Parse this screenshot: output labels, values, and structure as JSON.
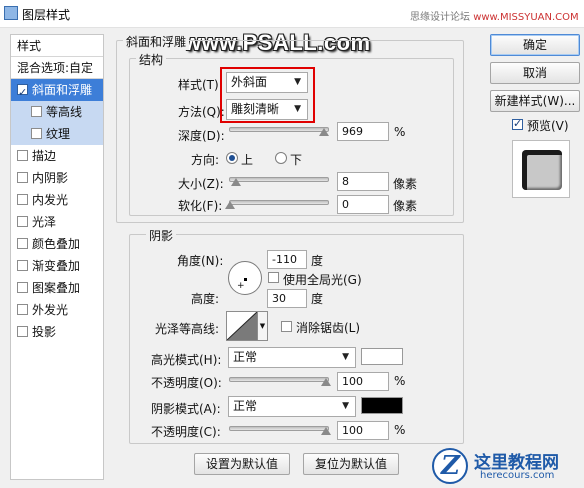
{
  "window": {
    "title": "图层样式"
  },
  "watermarks": {
    "top_text": "思缘设计论坛",
    "top_url": "www.MISSYUAN.COM",
    "overlay": "www.PSALL.com",
    "bottom_name": "这里教程网",
    "bottom_url": "herecours.com",
    "bottom_badge_letter": "Z"
  },
  "sidebar": {
    "header": "样式",
    "blend_options": "混合选项:自定",
    "items": [
      {
        "label": "斜面和浮雕",
        "checked": true,
        "selected": true
      },
      {
        "label": "等高线",
        "checked": false,
        "sub": true
      },
      {
        "label": "纹理",
        "checked": false,
        "sub": true
      },
      {
        "label": "描边",
        "checked": false
      },
      {
        "label": "内阴影",
        "checked": false
      },
      {
        "label": "内发光",
        "checked": false
      },
      {
        "label": "光泽",
        "checked": false
      },
      {
        "label": "颜色叠加",
        "checked": false
      },
      {
        "label": "渐变叠加",
        "checked": false
      },
      {
        "label": "图案叠加",
        "checked": false
      },
      {
        "label": "外发光",
        "checked": false
      },
      {
        "label": "投影",
        "checked": false
      }
    ]
  },
  "bevel": {
    "section_title": "斜面和浮雕",
    "structure_title": "结构",
    "style_label": "样式(T):",
    "style_value": "外斜面",
    "technique_label": "方法(Q):",
    "technique_value": "雕刻清晰",
    "depth_label": "深度(D):",
    "depth_value": "969",
    "depth_unit": "%",
    "depth_level": 1.0,
    "direction_label": "方向:",
    "direction_up": "上",
    "direction_down": "下",
    "direction_selected": "up",
    "size_label": "大小(Z):",
    "size_value": "8",
    "size_unit": "像素",
    "soften_label": "软化(F):",
    "soften_value": "0",
    "soften_unit": "像素"
  },
  "shading": {
    "title": "阴影",
    "angle_label": "角度(N):",
    "angle_value": "-110",
    "angle_unit": "度",
    "global_light_label": "使用全局光(G)",
    "global_light_checked": false,
    "altitude_label": "高度:",
    "altitude_value": "30",
    "altitude_unit": "度",
    "gloss_contour_label": "光泽等高线:",
    "anti_alias_label": "消除锯齿(L)",
    "anti_alias_checked": false,
    "highlight_mode_label": "高光模式(H):",
    "highlight_mode_value": "正常",
    "highlight_color": "#ffffff",
    "highlight_opacity_label": "不透明度(O):",
    "highlight_opacity_value": "100",
    "shadow_mode_label": "阴影模式(A):",
    "shadow_mode_value": "正常",
    "shadow_color": "#000000",
    "shadow_opacity_label": "不透明度(C):",
    "shadow_opacity_value": "100",
    "percent": "%"
  },
  "buttons": {
    "ok": "确定",
    "cancel": "取消",
    "new_style": "新建样式(W)...",
    "preview_label": "预览(V)",
    "preview_checked": true,
    "make_default": "设置为默认值",
    "reset_default": "复位为默认值"
  },
  "colors": {
    "accent": "#3d7ed8",
    "highlight_box": "#e00000"
  }
}
